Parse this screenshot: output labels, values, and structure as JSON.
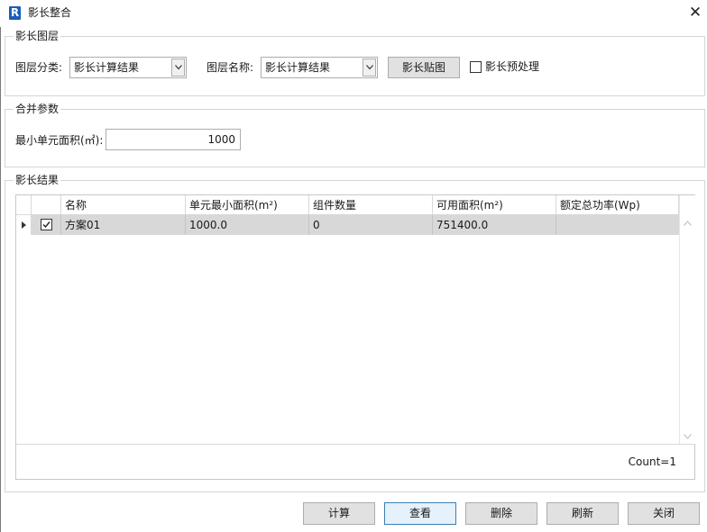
{
  "window": {
    "title": "影长整合",
    "app_icon": "R",
    "close": "✕"
  },
  "shadow_layer_group": {
    "legend": "影长图层",
    "layer_category_label": "图层分类:",
    "layer_category_value": "影长计算结果",
    "layer_name_label": "图层名称:",
    "layer_name_value": "影长计算结果",
    "shadow_map_button": "影长贴图",
    "preprocess_label": "影长预处理",
    "preprocess_checked": false
  },
  "merge_params_group": {
    "legend": "合并参数",
    "min_unit_area_label": "最小单元面积(㎡):",
    "min_unit_area_value": "1000"
  },
  "results_group": {
    "legend": "影长结果",
    "columns": [
      "名称",
      "单元最小面积(m²)",
      "组件数量",
      "可用面积(m²)",
      "额定总功率(Wp)"
    ],
    "rows": [
      {
        "checked": true,
        "name": "方案01",
        "min_unit_area": "1000.0",
        "component_count": "0",
        "usable_area": "751400.0",
        "rated_power": ""
      }
    ],
    "count_text": "Count=1"
  },
  "bottom_buttons": {
    "calculate": "计算",
    "view": "查看",
    "delete": "删除",
    "refresh": "刷新",
    "close": "关闭"
  },
  "colors": {
    "accent": "#1a5db5",
    "focus_border": "#3c7fb1",
    "selected_row": "#d8d8d8"
  }
}
